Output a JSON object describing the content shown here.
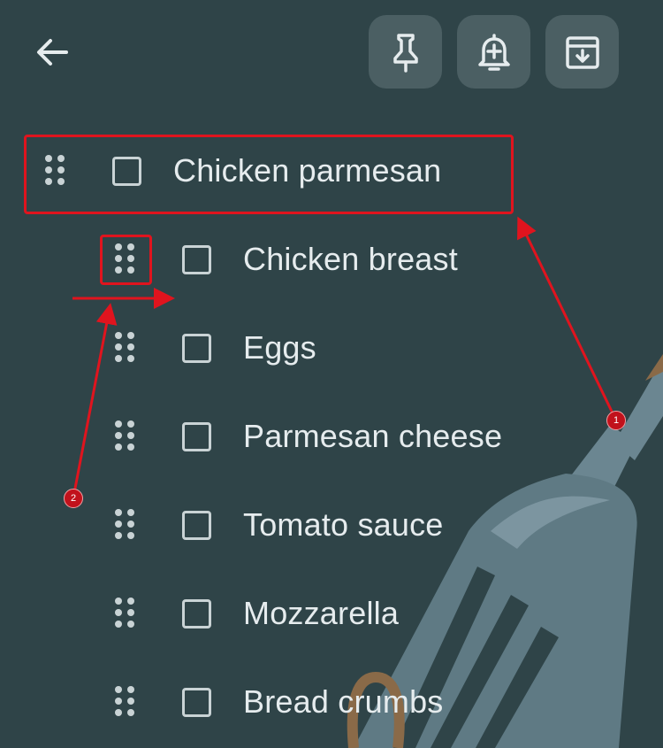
{
  "toolbar": {
    "back_icon": "arrow-left-icon",
    "buttons": [
      {
        "name": "pin",
        "icon": "pin-icon"
      },
      {
        "name": "reminder",
        "icon": "bell-plus-icon"
      },
      {
        "name": "archive",
        "icon": "archive-icon"
      }
    ]
  },
  "list": {
    "parent": {
      "label": "Chicken parmesan"
    },
    "items": [
      {
        "label": "Chicken breast"
      },
      {
        "label": "Eggs"
      },
      {
        "label": "Parmesan cheese"
      },
      {
        "label": "Tomato sauce"
      },
      {
        "label": "Mozzarella"
      },
      {
        "label": "Bread crumbs"
      }
    ]
  },
  "annotations": [
    {
      "number": "1"
    },
    {
      "number": "2"
    }
  ],
  "colors": {
    "background": "#2f4448",
    "button_background": "#4b5f63",
    "annotation_red": "#e0141e",
    "text": "#e6ecee"
  }
}
